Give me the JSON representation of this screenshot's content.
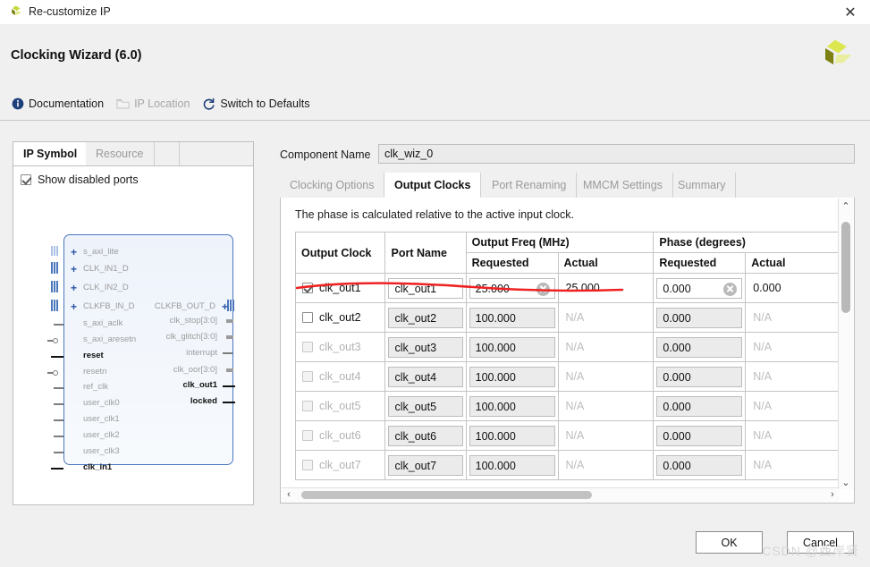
{
  "window": {
    "title": "Re-customize IP",
    "app_icon": "xilinx-logo-icon",
    "close_label": "✕"
  },
  "header": {
    "wizard_title": "Clocking Wizard (6.0)",
    "logo": "xilinx-logo-icon",
    "actions": [
      {
        "label": "Documentation",
        "icon": "info-icon",
        "enabled": true
      },
      {
        "label": "IP Location",
        "icon": "folder-icon",
        "enabled": false
      },
      {
        "label": "Switch to Defaults",
        "icon": "refresh-icon",
        "enabled": true
      }
    ]
  },
  "left_panel": {
    "tabs": [
      {
        "label": "IP Symbol",
        "active": true
      },
      {
        "label": "Resource",
        "active": false
      }
    ],
    "show_disabled_ports": {
      "label": "Show disabled ports",
      "checked": true
    },
    "symbol": {
      "inputs": [
        {
          "name": "s_axi_lite",
          "type": "bus",
          "enabled": false
        },
        {
          "name": "CLK_IN1_D",
          "type": "bus",
          "enabled": false
        },
        {
          "name": "CLK_IN2_D",
          "type": "bus",
          "enabled": false
        },
        {
          "name": "CLKFB_IN_D",
          "type": "bus",
          "enabled": false
        },
        {
          "name": "s_axi_aclk",
          "type": "pin",
          "enabled": false
        },
        {
          "name": "s_axi_aresetn",
          "type": "npin",
          "enabled": false
        },
        {
          "name": "reset",
          "type": "pin",
          "enabled": true
        },
        {
          "name": "resetn",
          "type": "npin",
          "enabled": false
        },
        {
          "name": "ref_clk",
          "type": "pin",
          "enabled": false
        },
        {
          "name": "user_clk0",
          "type": "pin",
          "enabled": false
        },
        {
          "name": "user_clk1",
          "type": "pin",
          "enabled": false
        },
        {
          "name": "user_clk2",
          "type": "pin",
          "enabled": false
        },
        {
          "name": "user_clk3",
          "type": "pin",
          "enabled": false
        },
        {
          "name": "clk_in1",
          "type": "pin",
          "enabled": true
        }
      ],
      "outputs": [
        {
          "name": "CLKFB_OUT_D",
          "type": "bus",
          "enabled": false
        },
        {
          "name": "clk_stop[3:0]",
          "type": "stub",
          "enabled": false
        },
        {
          "name": "clk_glitch[3:0]",
          "type": "stub",
          "enabled": false
        },
        {
          "name": "interrupt",
          "type": "pin",
          "enabled": false
        },
        {
          "name": "clk_oor[3:0]",
          "type": "stub",
          "enabled": false
        },
        {
          "name": "clk_out1",
          "type": "pin",
          "enabled": true
        },
        {
          "name": "locked",
          "type": "pin",
          "enabled": true
        }
      ]
    }
  },
  "component": {
    "label": "Component Name",
    "value": "clk_wiz_0"
  },
  "right_panel": {
    "tabs": [
      {
        "label": "Clocking Options",
        "active": false
      },
      {
        "label": "Output Clocks",
        "active": true
      },
      {
        "label": "Port Renaming",
        "active": false
      },
      {
        "label": "MMCM Settings",
        "active": false
      },
      {
        "label": "Summary",
        "active": false
      }
    ],
    "hint": "The phase is calculated relative to the active input clock.",
    "table": {
      "group_headers": {
        "output_clock": "Output Clock",
        "port_name": "Port Name",
        "output_freq": "Output Freq (MHz)",
        "phase": "Phase (degrees)"
      },
      "sub_headers": {
        "freq_requested": "Requested",
        "freq_actual": "Actual",
        "phase_requested": "Requested",
        "phase_actual": "Actual"
      },
      "rows": [
        {
          "clock": "clk_out1",
          "checked": true,
          "enabled": true,
          "port_name": "clk_out1",
          "freq_requested": "25.000",
          "freq_actual": "25.000",
          "phase_requested": "0.000",
          "phase_actual": "0.000",
          "has_clear": true
        },
        {
          "clock": "clk_out2",
          "checked": false,
          "enabled": true,
          "port_name": "clk_out2",
          "freq_requested": "100.000",
          "freq_actual": "N/A",
          "phase_requested": "0.000",
          "phase_actual": "N/A",
          "has_clear": false
        },
        {
          "clock": "clk_out3",
          "checked": false,
          "enabled": false,
          "port_name": "clk_out3",
          "freq_requested": "100.000",
          "freq_actual": "N/A",
          "phase_requested": "0.000",
          "phase_actual": "N/A",
          "has_clear": false
        },
        {
          "clock": "clk_out4",
          "checked": false,
          "enabled": false,
          "port_name": "clk_out4",
          "freq_requested": "100.000",
          "freq_actual": "N/A",
          "phase_requested": "0.000",
          "phase_actual": "N/A",
          "has_clear": false
        },
        {
          "clock": "clk_out5",
          "checked": false,
          "enabled": false,
          "port_name": "clk_out5",
          "freq_requested": "100.000",
          "freq_actual": "N/A",
          "phase_requested": "0.000",
          "phase_actual": "N/A",
          "has_clear": false
        },
        {
          "clock": "clk_out6",
          "checked": false,
          "enabled": false,
          "port_name": "clk_out6",
          "freq_requested": "100.000",
          "freq_actual": "N/A",
          "phase_requested": "0.000",
          "phase_actual": "N/A",
          "has_clear": false
        },
        {
          "clock": "clk_out7",
          "checked": false,
          "enabled": false,
          "port_name": "clk_out7",
          "freq_requested": "100.000",
          "freq_actual": "N/A",
          "phase_requested": "0.000",
          "phase_actual": "N/A",
          "has_clear": false
        }
      ]
    },
    "scroll": {
      "up_arrow": "⌃",
      "down_arrow": "⌄",
      "left_arrow": "‹",
      "right_arrow": "›"
    }
  },
  "footer": {
    "ok_label": "OK",
    "cancel_label": "Cancel"
  },
  "annotation": {
    "color": "#ee2222"
  },
  "watermark": "CSDN @西岸贤"
}
